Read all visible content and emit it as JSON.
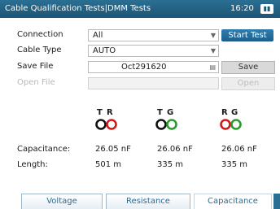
{
  "titlebar": {
    "title": "Cable Qualification Tests|DMM Tests",
    "time": "16:20",
    "status_icon": "battery-icon"
  },
  "form": {
    "connection": {
      "label": "Connection",
      "value": "All"
    },
    "cable_type": {
      "label": "Cable Type",
      "value": "AUTO"
    },
    "save_file": {
      "label": "Save File",
      "value": "Oct291620"
    },
    "open_file": {
      "label": "Open File",
      "value": ""
    }
  },
  "buttons": {
    "start_test": "Start Test",
    "save": "Save",
    "open": "Open"
  },
  "pairs": [
    {
      "a": "T",
      "b": "R",
      "a_color": "#111111",
      "b_color": "#d11919"
    },
    {
      "a": "T",
      "b": "G",
      "a_color": "#111111",
      "b_color": "#2a9a2a"
    },
    {
      "a": "R",
      "b": "G",
      "a_color": "#d11919",
      "b_color": "#2a9a2a"
    }
  ],
  "measurements": {
    "capacitance_label": "Capacitance:",
    "length_label": "Length:",
    "capacitance": [
      "26.05 nF",
      "26.06 nF",
      "26.06 nF"
    ],
    "length": [
      "501 m",
      "335 m",
      "335 m"
    ]
  },
  "tabs": [
    {
      "label": "Voltage",
      "active": false
    },
    {
      "label": "Resistance",
      "active": false
    },
    {
      "label": "Capacitance",
      "active": true
    }
  ]
}
